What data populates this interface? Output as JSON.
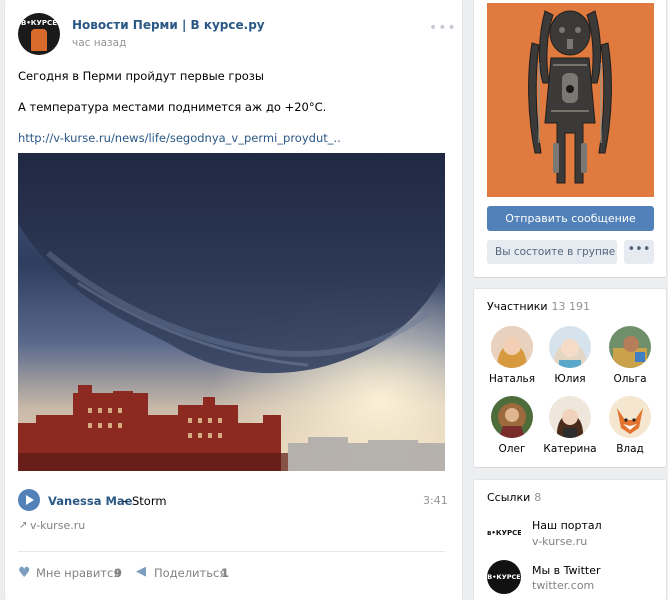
{
  "post": {
    "group_name": "Новости Перми | В курсе.ру",
    "time": "час назад",
    "more": "•••",
    "avatar_logo": "В•КУРСЕ",
    "text_line1": "Сегодня в Перми пройдут первые грозы",
    "text_line2": "А температура местами поднимется аж до +20°С.",
    "link_text": "http://v-kurse.ru/news/life/segodnya_v_permi_proydut_..",
    "audio": {
      "artist": "Vanessa Mae",
      "separator": "–",
      "title": "Storm",
      "duration": "3:41"
    },
    "source": "v-kurse.ru",
    "like_label": "Мне нравится",
    "like_count": "9",
    "share_label": "Поделиться",
    "share_count": "1",
    "icons": {
      "play": "play-icon",
      "like": "heart-icon",
      "share": "megaphone-icon",
      "source": "link-icon"
    }
  },
  "group": {
    "send_message": "Отправить сообщение",
    "membership": "Вы состоите в группе",
    "membership_chevron": "⌄",
    "more": "•••"
  },
  "members": {
    "title": "Участники",
    "count": "13 191",
    "list": [
      {
        "name": "Наталья"
      },
      {
        "name": "Юлия"
      },
      {
        "name": "Ольга"
      },
      {
        "name": "Олег"
      },
      {
        "name": "Катерина"
      },
      {
        "name": "Влад"
      }
    ]
  },
  "links": {
    "title": "Ссылки",
    "count": "8",
    "items": [
      {
        "logo": "в•КУРСЕ",
        "name": "Наш портал",
        "url": "v-kurse.ru"
      },
      {
        "logo": "В•КУРСЕ",
        "name": "Мы в Twitter",
        "url": "twitter.com"
      }
    ]
  },
  "colors": {
    "accent": "#5181b8",
    "link": "#2a5885",
    "cover_bg": "#e07a3e",
    "page_bg": "#edeef0"
  }
}
